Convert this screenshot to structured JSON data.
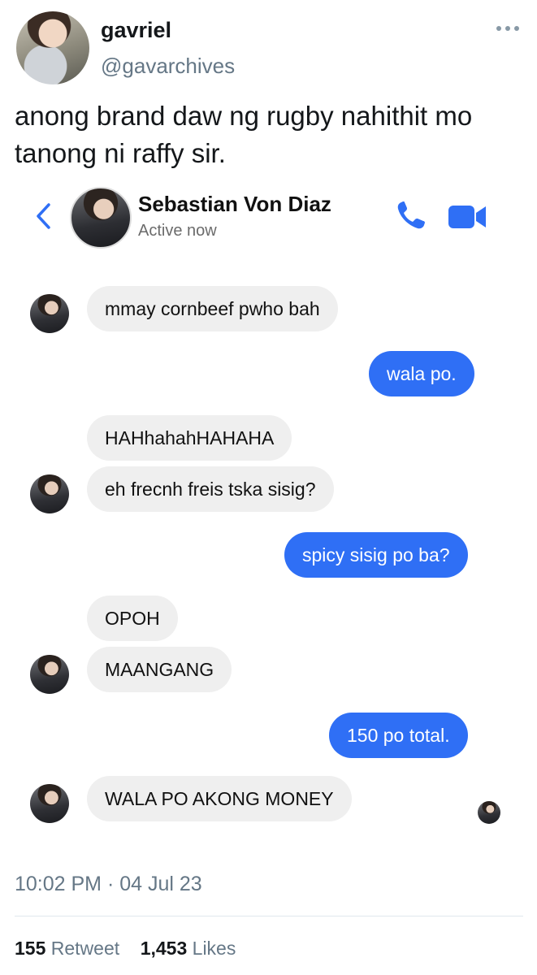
{
  "tweet": {
    "display_name": "gavriel",
    "handle": "@gavarchives",
    "text": "anong brand daw ng rugby nahithit mo tanong ni raffy sir.",
    "timestamp": "10:02 PM · 04 Jul 23",
    "retweets_count": "155",
    "retweets_label": "Retweet",
    "likes_count": "1,453",
    "likes_label": "Likes"
  },
  "icons": {
    "more": "more-icon",
    "back": "chevron-left-icon",
    "call": "phone-icon",
    "video": "video-camera-icon"
  },
  "colors": {
    "messenger_blue": "#2f6ff5",
    "incoming_bubble": "#efefef",
    "twitter_gray": "#657786"
  },
  "chat": {
    "contact_name": "Sebastian Von Diaz",
    "status": "Active now",
    "messages": [
      {
        "from": "contact",
        "text": "mmay cornbeef pwho bah"
      },
      {
        "from": "me",
        "text": "wala po."
      },
      {
        "from": "contact",
        "text": "HAHhahahHAHAHA"
      },
      {
        "from": "contact",
        "text": "eh frecnh freis tska sisig?"
      },
      {
        "from": "me",
        "text": "spicy sisig po ba?"
      },
      {
        "from": "contact",
        "text": "OPOH"
      },
      {
        "from": "contact",
        "text": "MAANGANG"
      },
      {
        "from": "me",
        "text": "150 po total."
      },
      {
        "from": "contact",
        "text": "WALA PO AKONG MONEY"
      }
    ]
  }
}
